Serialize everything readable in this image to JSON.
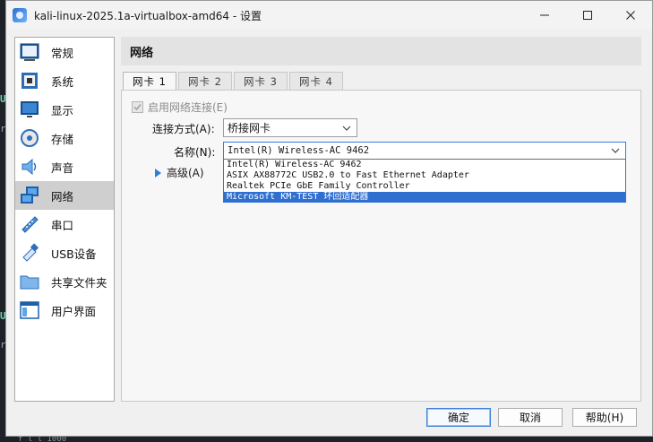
{
  "background": {
    "glyphs": [
      "U",
      "r",
      "U",
      "r"
    ],
    "bottom_text": "  f    l  l    1000"
  },
  "window": {
    "title": "kali-linux-2025.1a-virtualbox-amd64 - 设置",
    "controls": {
      "minimize": "—",
      "maximize": "☐",
      "close": "✕"
    }
  },
  "sidebar": {
    "items": [
      {
        "label": "常规",
        "icon": "general-icon"
      },
      {
        "label": "系统",
        "icon": "system-chip-icon"
      },
      {
        "label": "显示",
        "icon": "display-monitor-icon"
      },
      {
        "label": "存储",
        "icon": "storage-disk-icon"
      },
      {
        "label": "声音",
        "icon": "speaker-icon"
      },
      {
        "label": "网络",
        "icon": "network-icon",
        "active": true
      },
      {
        "label": "串口",
        "icon": "serial-port-icon"
      },
      {
        "label": "USB设备",
        "icon": "usb-icon"
      },
      {
        "label": "共享文件夹",
        "icon": "shared-folder-icon"
      },
      {
        "label": "用户界面",
        "icon": "user-interface-icon"
      }
    ]
  },
  "content": {
    "section_title": "网络",
    "tabs": [
      "网卡 1",
      "网卡 2",
      "网卡 3",
      "网卡 4"
    ],
    "active_tab": 0,
    "enable_adapter": {
      "label": "启用网络连接(E)",
      "checked": true,
      "disabled": true
    },
    "attached_to": {
      "label": "连接方式(A):",
      "value": "桥接网卡"
    },
    "name": {
      "label": "名称(N):",
      "value": "Intel(R) Wireless-AC 9462"
    },
    "name_options": [
      "Intel(R) Wireless-AC 9462",
      "ASIX AX88772C USB2.0 to Fast Ethernet Adapter",
      "Realtek PCIe GbE Family Controller",
      "Microsoft KM-TEST 环回适配器"
    ],
    "selected_option_index": 3,
    "advanced": {
      "label": "高级(A)"
    }
  },
  "buttons": {
    "ok": "确定",
    "cancel": "取消",
    "help": "帮助(H)"
  },
  "colors": {
    "accent": "#2f6fd0",
    "selected_sidebar": "#cfcfcf"
  }
}
